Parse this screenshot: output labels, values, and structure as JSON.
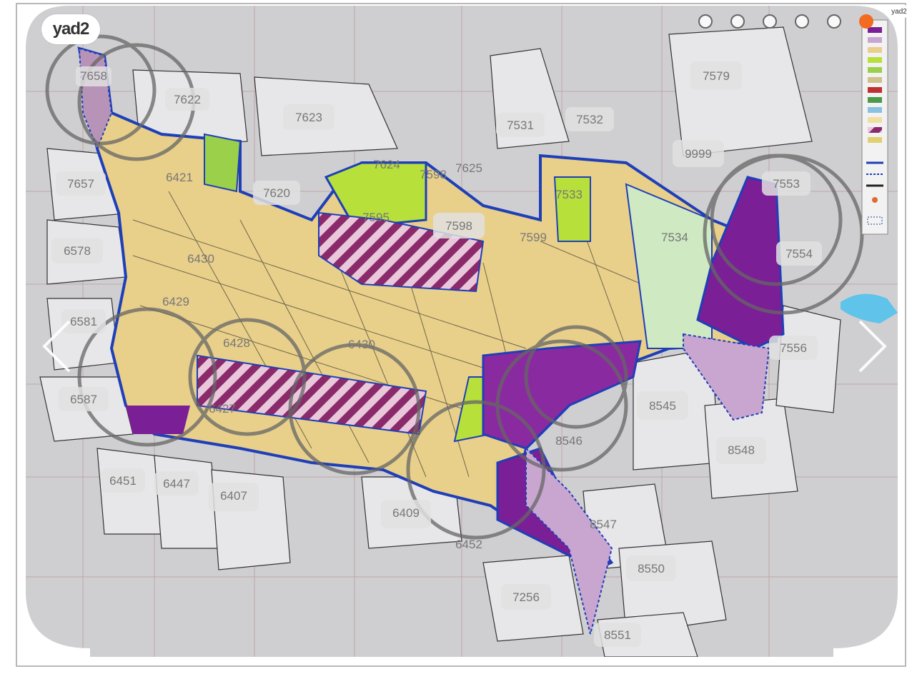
{
  "brand": {
    "logo_text": "yad2",
    "corner_badge": "yad2"
  },
  "gallery": {
    "image_count": 6,
    "active_index": 6,
    "accent_color": "#f26b21",
    "prev_icon": "chevron-left-icon",
    "next_icon": "chevron-right-icon"
  },
  "map": {
    "parcel_labels": [
      "7658",
      "7622",
      "7623",
      "7531",
      "7532",
      "7579",
      "9999",
      "7553",
      "7554",
      "7556",
      "7657",
      "7620",
      "7595",
      "7598",
      "7599",
      "7533",
      "7534",
      "6578",
      "6430",
      "6581",
      "6429",
      "6428",
      "6430",
      "6427",
      "6587",
      "6451",
      "6447",
      "6407",
      "6409",
      "6452",
      "8545",
      "8546",
      "8548",
      "8547",
      "8550",
      "7256",
      "8551",
      "6421",
      "7598",
      "7624",
      "7625"
    ]
  }
}
